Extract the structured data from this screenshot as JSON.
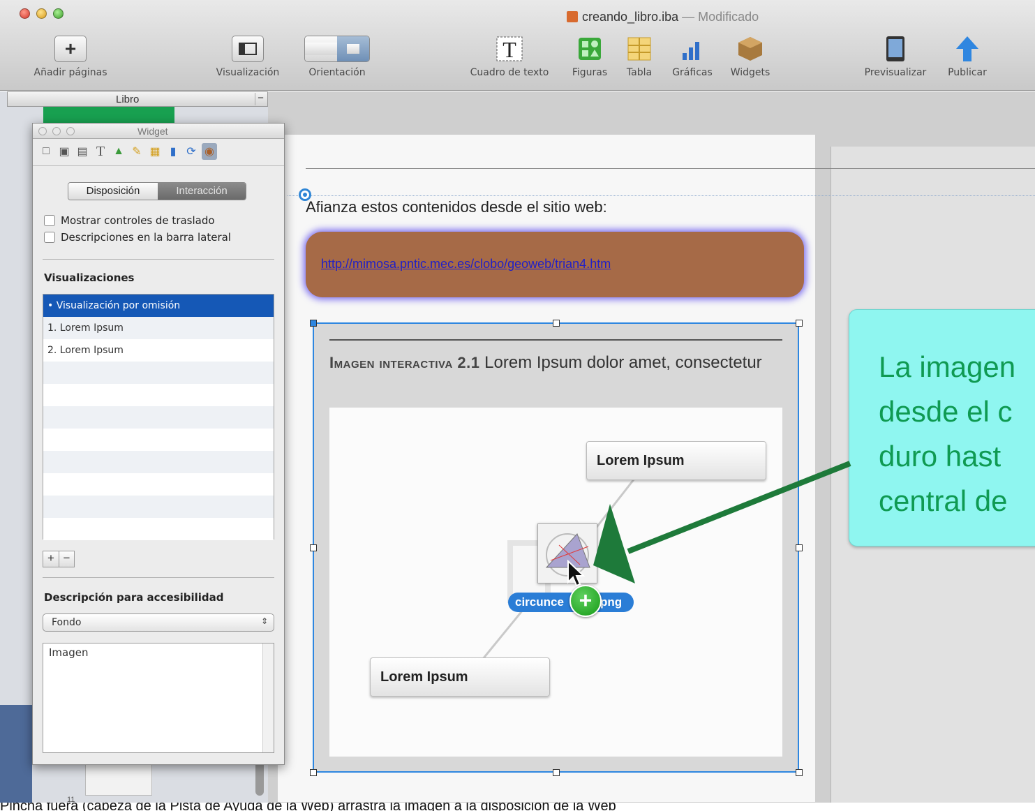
{
  "window": {
    "document_name": "creando_libro.iba",
    "separator": "—",
    "status": "Modificado"
  },
  "toolbar": {
    "add_pages": "Añadir páginas",
    "view": "Visualización",
    "orientation": "Orientación",
    "text_box": "Cuadro de texto",
    "shapes": "Figuras",
    "table": "Tabla",
    "charts": "Gráficas",
    "widgets": "Widgets",
    "preview": "Previsualizar",
    "publish": "Publicar"
  },
  "sidebar": {
    "header": "Libro",
    "collapse": "−",
    "page_number": "11"
  },
  "inspector": {
    "title": "Widget",
    "tabs": [
      "Disposición",
      "Interacción"
    ],
    "checkboxes": [
      "Mostrar controles de traslado",
      "Descripciones en la barra lateral"
    ],
    "views_heading": "Visualizaciones",
    "views": [
      "• Visualización por omisión",
      "1. Lorem Ipsum",
      "2. Lorem Ipsum"
    ],
    "add": "+",
    "remove": "−",
    "accessibility_heading": "Descripción para accesibilidad",
    "accessibility_select": "Fondo",
    "accessibility_text": "Imagen"
  },
  "page": {
    "intro": "Afianza estos contenidos desde el sitio web:",
    "link": "http://mimosa.pntic.mec.es/clobo/geoweb/trian4.htm",
    "widget": {
      "label": "Imagen interactiva 2.1",
      "caption": "Lorem Ipsum dolor amet, consectetur",
      "callout_top": "Lorem Ipsum",
      "callout_bottom": "Lorem Ipsum",
      "file_start": "circunce",
      "file_end": "png",
      "add": "+"
    }
  },
  "note": {
    "text": "La imagen\ndesde el c\nduro hast\ncentral de",
    "color": "#0f9a52",
    "background": "#8ff6f0"
  },
  "footer": {
    "text": "Pincha fuera (cabeza de la Pista de Ayuda de la Web) arrastra la imagen a la disposición de la Web"
  },
  "colors": {
    "selection": "#2d86e0",
    "link_box": "#a66a47",
    "arrow": "#1e7a3a"
  }
}
